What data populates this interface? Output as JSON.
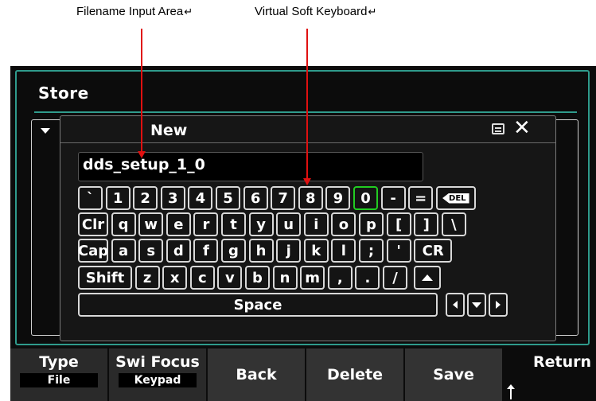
{
  "callouts": {
    "filename": "Filename Input Area",
    "keyboard": "Virtual Soft Keyboard",
    "return_mark": "↵"
  },
  "screen": {
    "title": "Store",
    "dialog_title": "New",
    "filename_value": "dds_setup_1_0"
  },
  "keyboard": {
    "row1": [
      "`",
      "1",
      "2",
      "3",
      "4",
      "5",
      "6",
      "7",
      "8",
      "9",
      "0",
      "-",
      "=",
      "DEL"
    ],
    "row2": [
      "Clr",
      "q",
      "w",
      "e",
      "r",
      "t",
      "y",
      "u",
      "i",
      "o",
      "p",
      "[",
      "]",
      "\\"
    ],
    "row3": [
      "Cap",
      "a",
      "s",
      "d",
      "f",
      "g",
      "h",
      "j",
      "k",
      "l",
      ";",
      "'",
      "CR"
    ],
    "row4": [
      "Shift",
      "z",
      "x",
      "c",
      "v",
      "b",
      "n",
      "m",
      ",",
      ".",
      "/"
    ],
    "space": "Space",
    "focused_key": "0"
  },
  "softkeys": {
    "type_label": "Type",
    "type_value": "File",
    "focus_label": "Swi Focus",
    "focus_value": "Keypad",
    "back": "Back",
    "delete": "Delete",
    "save": "Save",
    "return": "Return"
  },
  "colors": {
    "accent_frame": "#2f9b8c",
    "focus_key": "#22cc22",
    "callout_arrow": "#e01010"
  }
}
